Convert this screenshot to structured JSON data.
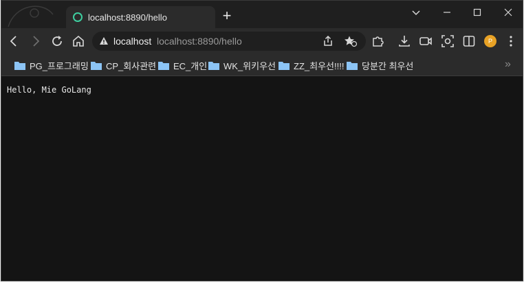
{
  "tab": {
    "title": "localhost:8890/hello",
    "new_tab_label": "+"
  },
  "address_bar": {
    "host": "localhost",
    "url": "localhost:8890/hello"
  },
  "profile": {
    "initial": "P",
    "color": "#e8a225"
  },
  "bookmarks": {
    "items": [
      {
        "label": "PG_프로그래밍"
      },
      {
        "label": "CP_회사관련"
      },
      {
        "label": "EC_개인"
      },
      {
        "label": "WK_위키우선"
      },
      {
        "label": "ZZ_최우선!!!!"
      },
      {
        "label": "당분간 최우선"
      }
    ],
    "overflow_label": "»"
  },
  "page": {
    "text": "Hello, Mie GoLang"
  },
  "colors": {
    "accent": "#3ecfa0",
    "folder": "#8cc4f5",
    "background": "#141414"
  }
}
